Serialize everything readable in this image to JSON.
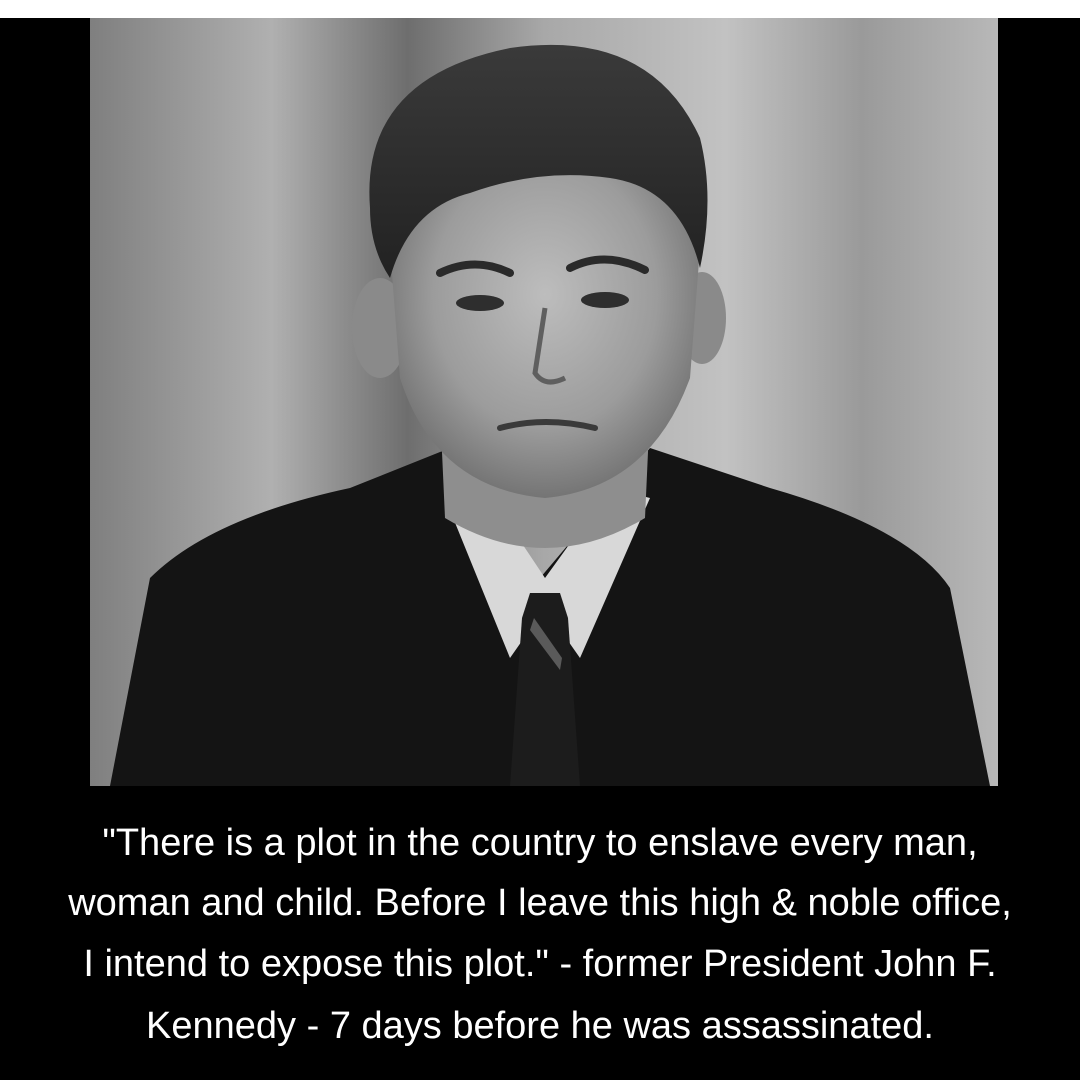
{
  "photo": {
    "subject": "portrait-photo"
  },
  "quote": {
    "lines": [
      "\"There is a plot in the country to enslave every man,",
      "woman and child. Before I leave this high & noble office,",
      "I intend to expose this plot.\" - former President John F.",
      "Kennedy - 7 days before he was assassinated."
    ]
  },
  "colors": {
    "background": "#000000",
    "text": "#ffffff",
    "top_strip": "#ffffff"
  }
}
